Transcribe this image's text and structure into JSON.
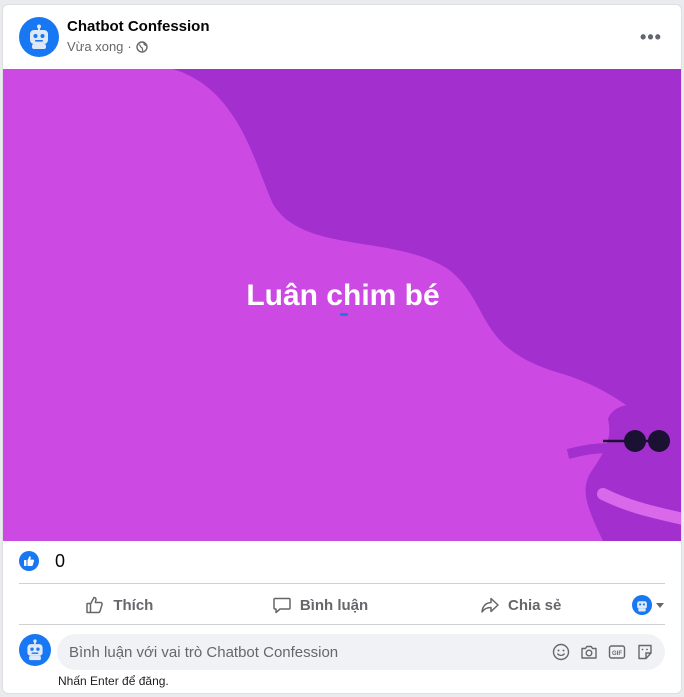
{
  "post": {
    "author": "Chatbot Confession",
    "time": "Vừa xong",
    "time_sep": "·",
    "privacy_icon": "globe-icon",
    "text": "Luân chim bé",
    "background_color": "#cc4ae3"
  },
  "reactions": {
    "icon": "like-icon",
    "count": "0"
  },
  "actions": {
    "like": "Thích",
    "comment": "Bình luận",
    "share": "Chia sẻ"
  },
  "comment": {
    "placeholder": "Bình luận với vai trò Chatbot Confession",
    "hint": "Nhấn Enter để đăng."
  },
  "colors": {
    "accent": "#1877f2",
    "post_background": "#cc4ae3",
    "post_wave": "#a42fcf"
  }
}
